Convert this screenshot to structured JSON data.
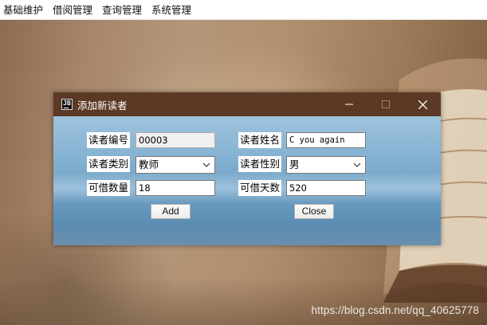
{
  "menubar": {
    "items": [
      "基础维护",
      "借阅管理",
      "查询管理",
      "系统管理"
    ]
  },
  "dialog": {
    "title": "添加新读者",
    "icon_text": "JB",
    "icons": {
      "app": "jetbrains-icon",
      "minimize": "minimize-icon",
      "maximize": "maximize-icon",
      "close": "close-icon"
    },
    "form": {
      "reader_id_label": "读者编号",
      "reader_id_value": "00003",
      "reader_name_label": "读者姓名",
      "reader_name_value": "C you again",
      "reader_type_label": "读者类别",
      "reader_type_value": "教师",
      "reader_gender_label": "读者性别",
      "reader_gender_value": "男",
      "borrow_count_label": "可借数量",
      "borrow_count_value": "18",
      "borrow_days_label": "可借天数",
      "borrow_days_value": "520"
    },
    "buttons": {
      "add": "Add",
      "close": "Close"
    }
  },
  "watermark": "https://blog.csdn.net/qq_40625778",
  "colors": {
    "titlebar": "#5b3924",
    "menubar": "#ffffff",
    "dialog_body": "#86b3d3"
  }
}
